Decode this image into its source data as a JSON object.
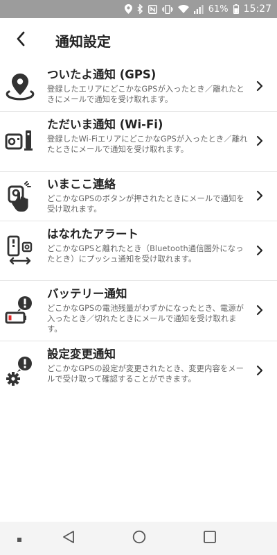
{
  "status_bar": {
    "battery_percent": "61%",
    "time": "15:27",
    "icons": [
      "location-icon",
      "bluetooth-icon",
      "nfc-icon",
      "vibrate-icon",
      "wifi-icon",
      "signal-icon",
      "battery-icon"
    ]
  },
  "header": {
    "back_icon": "back-arrow-icon",
    "title": "通知設定"
  },
  "items": [
    {
      "title": "ついたよ通知 (GPS)",
      "description": "登録したエリアにどこかなGPSが入ったとき／離れたときにメールで通知を受け取れます。",
      "icon": "location-pin-icon"
    },
    {
      "title": "ただいま通知 (Wi-Fi)",
      "description": "登録したWi-FiエリアにどこかなGPSが入ったとき／離れたときにメールで通知を受け取れます。",
      "icon": "wifi-router-icon"
    },
    {
      "title": "いまここ連絡",
      "description": "どこかなGPSのボタンが押されたときにメールで通知を受け取れます。",
      "icon": "button-press-icon"
    },
    {
      "title": "はなれたアラート",
      "description": "どこかなGPSと離れたとき（Bluetooth通信圏外になったとき）にプッシュ通知を受け取れます。",
      "icon": "phone-device-distance-icon"
    },
    {
      "title": "バッテリー通知",
      "description": "どこかなGPSの電池残量がわずかになったとき、電源が入ったとき／切れたときにメールで通知を受け取れます。",
      "icon": "battery-alert-icon"
    },
    {
      "title": "設定変更通知",
      "description": "どこかなGPSの設定が変更されたとき、変更内容をメールで受け取って確認することができます。",
      "icon": "settings-alert-icon"
    }
  ],
  "nav_bar": {
    "icons": [
      "menu-dot-icon",
      "back-triangle-icon",
      "home-circle-icon",
      "recents-square-icon"
    ]
  }
}
